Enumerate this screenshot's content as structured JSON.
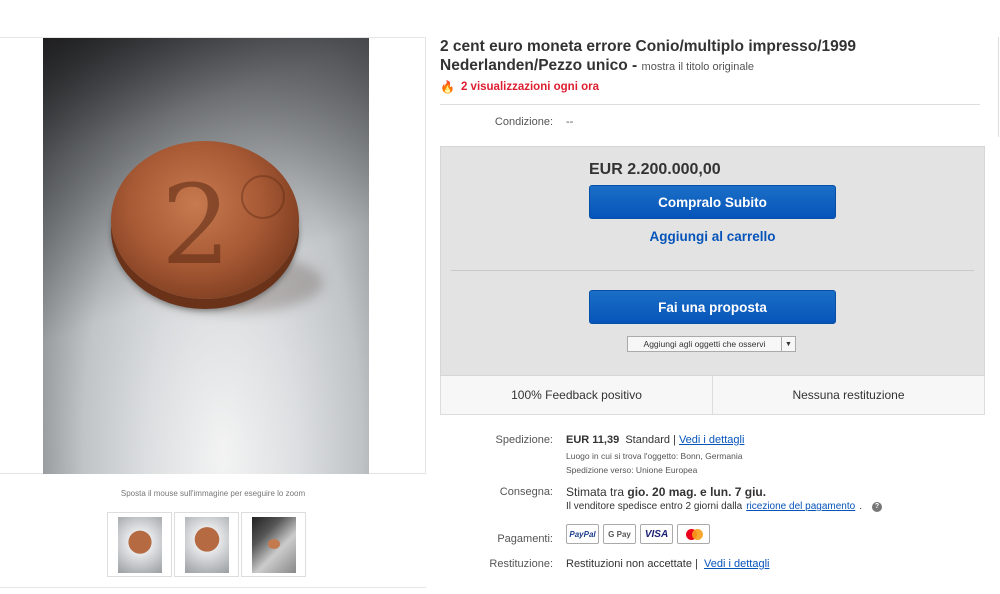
{
  "listing": {
    "title_line1": "2 cent euro moneta errore Conio/multiplo impresso/1999",
    "title_line2": "Nederlanden/Pezzo unico -",
    "show_original": "mostra il titolo originale",
    "views": "2 visualizzazioni ogni ora"
  },
  "gallery": {
    "zoom_hint": "Sposta il mouse sull'immagine per eseguire lo zoom",
    "main_image_alt": "2",
    "thumbnails": [
      "thumb-1",
      "thumb-2",
      "thumb-3"
    ]
  },
  "condition": {
    "label": "Condizione:",
    "value": "--"
  },
  "buybox": {
    "price": "EUR 2.200.000,00",
    "buy_now": "Compralo Subito",
    "add_to_cart": "Aggiungi al carrello",
    "make_offer": "Fai una proposta",
    "watch": "Aggiungi agli oggetti che osservi"
  },
  "feedback": {
    "positive": "100% Feedback positivo",
    "returns": "Nessuna restituzione"
  },
  "shipping": {
    "label": "Spedizione:",
    "cost": "EUR 11,39",
    "method": "Standard |",
    "details_link": "Vedi i dettagli",
    "location": "Luogo in cui si trova l'oggetto: Bonn, Germania",
    "ship_to": "Spedizione verso: Unione Europea"
  },
  "delivery": {
    "label": "Consegna:",
    "estimate_prefix": "Stimata tra",
    "estimate_range": "gio. 20 mag. e lun. 7 giu.",
    "dispatch_text": "Il venditore spedisce entro 2 giorni dalla",
    "dispatch_link": "ricezione del pagamento",
    "dispatch_suffix": "."
  },
  "payments": {
    "label": "Pagamenti:",
    "methods": [
      "PayPal",
      "G Pay",
      "VISA",
      "Mastercard"
    ]
  },
  "returns": {
    "label": "Restituzione:",
    "value": "Restituzioni non accettate |",
    "details_link": "Vedi i dettagli"
  },
  "colors": {
    "accent_blue": "#0654ba",
    "views_red": "#dd1e31",
    "buybox_bg": "#e3e3e3"
  },
  "icons": [
    "flame-icon",
    "dropdown-arrow-icon",
    "help-icon"
  ]
}
